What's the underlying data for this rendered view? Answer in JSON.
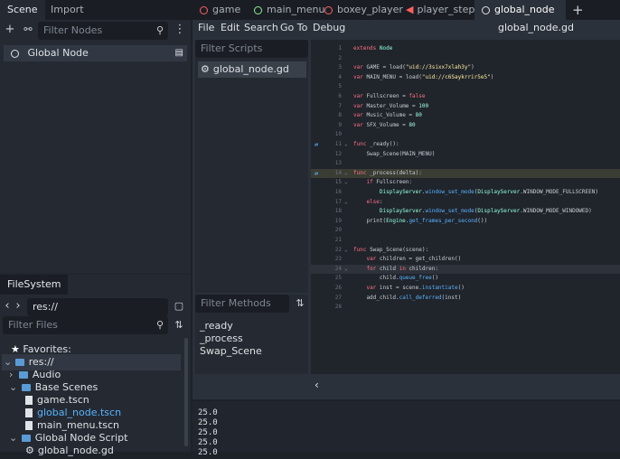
{
  "scene_dock": {
    "tabs": [
      "Scene",
      "Import"
    ],
    "filter_placeholder": "Filter Nodes",
    "root_node": "Global Node"
  },
  "filesystem": {
    "tab": "FileSystem",
    "path": "res://",
    "filter_placeholder": "Filter Files",
    "favorites": "Favorites:",
    "tree": [
      {
        "label": "res://",
        "kind": "folder"
      },
      {
        "label": "Audio",
        "kind": "folder"
      },
      {
        "label": "Base Scenes",
        "kind": "folder"
      },
      {
        "label": "game.tscn",
        "kind": "file"
      },
      {
        "label": "global_node.tscn",
        "kind": "file"
      },
      {
        "label": "main_menu.tscn",
        "kind": "file"
      },
      {
        "label": "Global Node Script",
        "kind": "folder"
      },
      {
        "label": "global_node.gd",
        "kind": "file"
      }
    ]
  },
  "editor_tabs": [
    {
      "label": "game",
      "color": "#ff5f5f"
    },
    {
      "label": "main_menu",
      "color": "#8eef97"
    },
    {
      "label": "boxey_player",
      "color": "#ff5f5f"
    },
    {
      "label": "player_step",
      "color": "#ff5f5f"
    },
    {
      "label": "global_node",
      "color": "#e0e0e0"
    }
  ],
  "add_tab": "+",
  "menu": [
    "File",
    "Edit",
    "Search",
    "Go To",
    "Debug"
  ],
  "script_title": "global_node.gd",
  "scripts": {
    "filter_placeholder": "Filter Scripts",
    "items": [
      "global_node.gd"
    ]
  },
  "methods": {
    "filter_placeholder": "Filter Methods",
    "items": [
      "_ready",
      "_process",
      "Swap_Scene"
    ]
  },
  "code": [
    {
      "n": "1",
      "t": "extends Node"
    },
    {
      "n": "2",
      "t": ""
    },
    {
      "n": "3",
      "t": "var GAME = load(\"uid://3sixx7xlah3y\")"
    },
    {
      "n": "4",
      "t": "var MAIN_MENU = load(\"uid://c6Saykrrir5e5\")"
    },
    {
      "n": "5",
      "t": ""
    },
    {
      "n": "6",
      "t": "var Fullscreen = false"
    },
    {
      "n": "7",
      "t": "var Master_Volume = 100"
    },
    {
      "n": "8",
      "t": "var Music_Volume = 80"
    },
    {
      "n": "9",
      "t": "var SFX_Volume = 80"
    },
    {
      "n": "10",
      "t": ""
    },
    {
      "n": "11",
      "t": "func _ready():"
    },
    {
      "n": "12",
      "t": "    Swap_Scene(MAIN_MENU)"
    },
    {
      "n": "13",
      "t": ""
    },
    {
      "n": "14",
      "t": "func _process(delta):"
    },
    {
      "n": "15",
      "t": "    if Fullscreen:"
    },
    {
      "n": "16",
      "t": "        DisplayServer.window_set_mode(DisplayServer.WINDOW_MODE_FULLSCREEN)"
    },
    {
      "n": "17",
      "t": "    else:"
    },
    {
      "n": "18",
      "t": "        DisplayServer.window_set_mode(DisplayServer.WINDOW_MODE_WINDOWED)"
    },
    {
      "n": "19",
      "t": "    print(Engine.get_frames_per_second())"
    },
    {
      "n": "20",
      "t": ""
    },
    {
      "n": "21",
      "t": ""
    },
    {
      "n": "22",
      "t": "func Swap_Scene(scene):"
    },
    {
      "n": "23",
      "t": "    var children = get_children()"
    },
    {
      "n": "24",
      "t": "    for child in children:"
    },
    {
      "n": "25",
      "t": "        child.queue_free()"
    },
    {
      "n": "26",
      "t": "    var inst = scene.instantiate()"
    },
    {
      "n": "27",
      "t": "    add_child.call_deferred(inst)"
    },
    {
      "n": "28",
      "t": ""
    }
  ],
  "output": [
    "25.0",
    "25.0",
    "25.0",
    "25.0",
    "25.0"
  ],
  "colors": {
    "accent": "#57b3ff",
    "keyword": "#ff7085",
    "string": "#ffeda1"
  }
}
